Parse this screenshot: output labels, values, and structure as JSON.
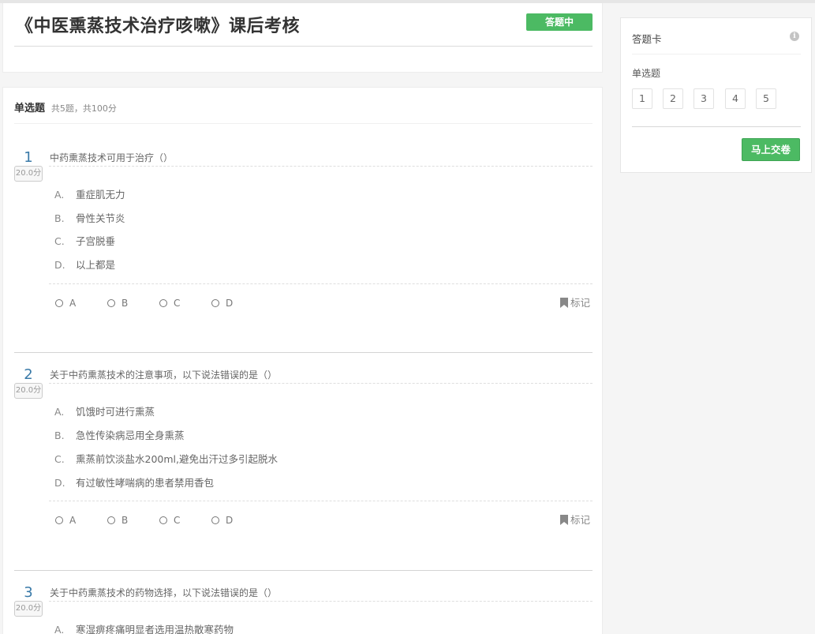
{
  "header": {
    "title": "《中医熏蒸技术治疗咳嗽》课后考核",
    "status": "答题中"
  },
  "section": {
    "title": "单选题",
    "meta": "共5题，共100分"
  },
  "mark_label": "标记",
  "answer_labels": [
    "A",
    "B",
    "C",
    "D"
  ],
  "questions": [
    {
      "number": "1",
      "score": "20.0分",
      "text": "中药熏蒸技术可用于治疗（）",
      "options": [
        {
          "letter": "A.",
          "text": "重症肌无力"
        },
        {
          "letter": "B.",
          "text": "骨性关节炎"
        },
        {
          "letter": "C.",
          "text": "子宫脱垂"
        },
        {
          "letter": "D.",
          "text": "以上都是"
        }
      ]
    },
    {
      "number": "2",
      "score": "20.0分",
      "text": "关于中药熏蒸技术的注意事项，以下说法错误的是（）",
      "options": [
        {
          "letter": "A.",
          "text": "饥饿时可进行熏蒸"
        },
        {
          "letter": "B.",
          "text": "急性传染病忌用全身熏蒸"
        },
        {
          "letter": "C.",
          "text": "熏蒸前饮淡盐水200ml,避免出汗过多引起脱水"
        },
        {
          "letter": "D.",
          "text": "有过敏性哮喘病的患者禁用香包"
        }
      ]
    },
    {
      "number": "3",
      "score": "20.0分",
      "text": "关于中药熏蒸技术的药物选择，以下说法错误的是（）",
      "options": [
        {
          "letter": "A.",
          "text": "寒湿痹疼痛明显者选用温热散寒药物"
        }
      ]
    }
  ],
  "answer_card": {
    "title": "答题卡",
    "section": "单选题",
    "numbers": [
      "1",
      "2",
      "3",
      "4",
      "5"
    ],
    "submit": "马上交卷"
  },
  "colors": {
    "accent_green": "#4cba63",
    "question_number_blue": "#3a7aa8"
  },
  "icons": [
    "info-icon",
    "bookmark-icon",
    "radio-icon"
  ]
}
